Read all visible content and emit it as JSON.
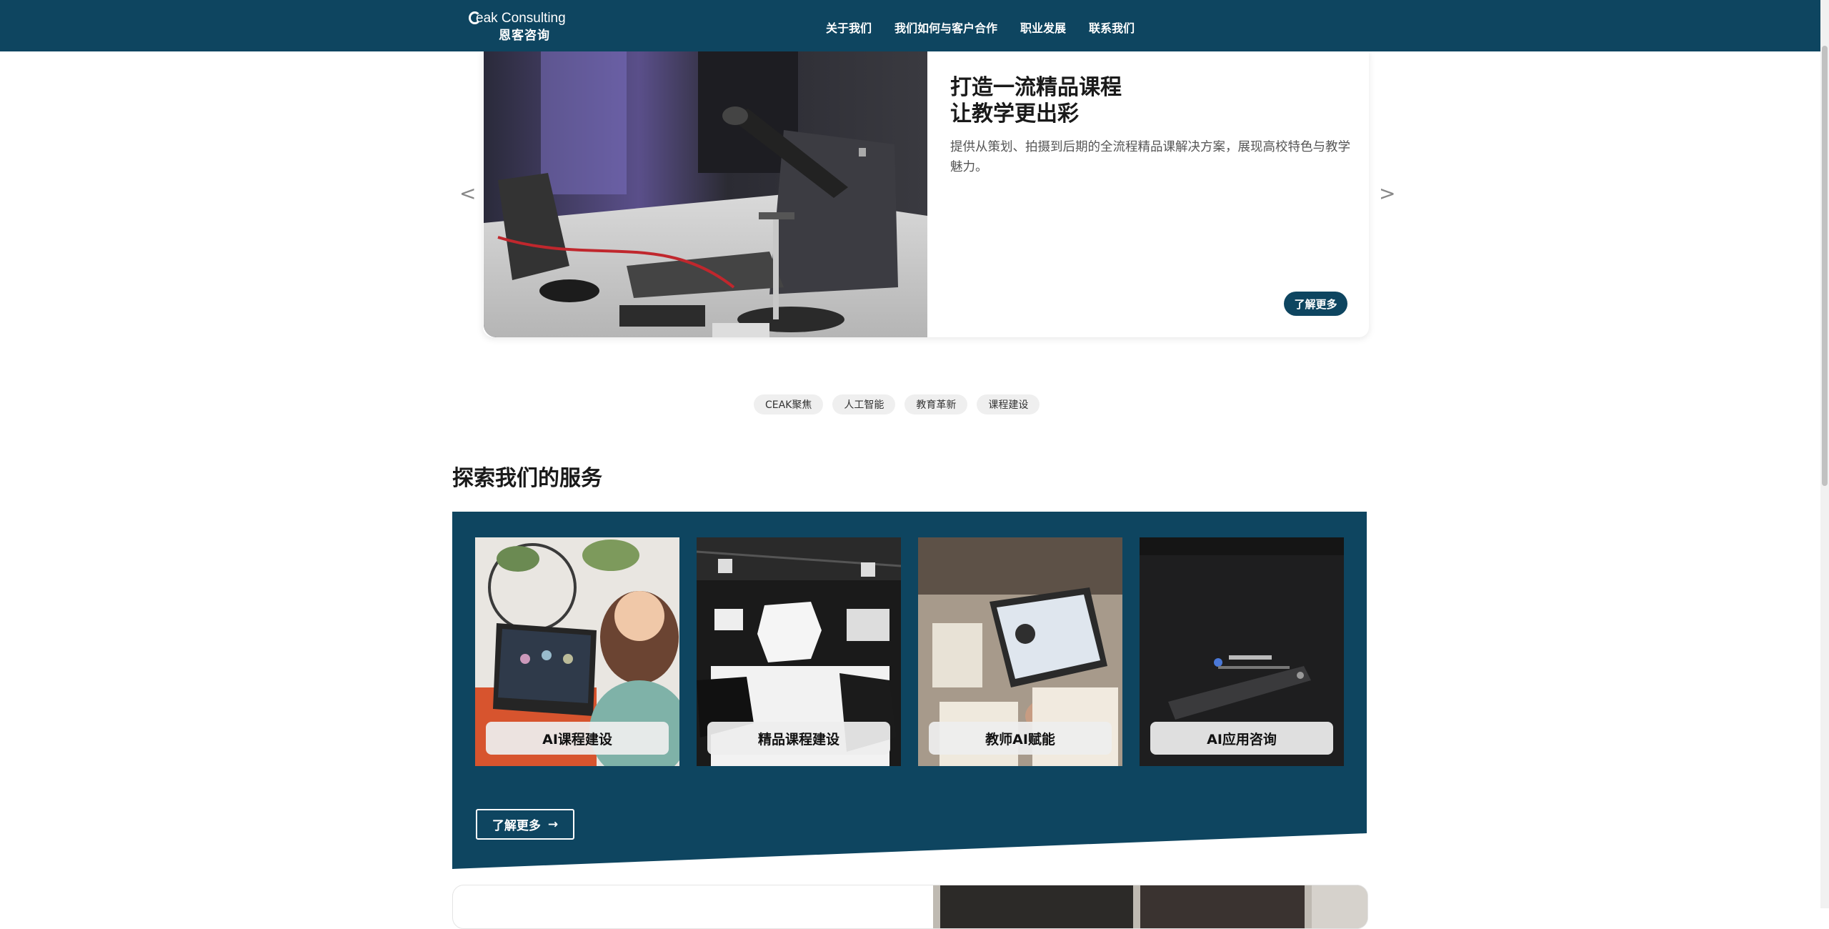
{
  "header": {
    "logo_en": "eak Consulting",
    "logo_cn": "恩客咨询",
    "nav": [
      "关于我们",
      "我们如何与客户合作",
      "职业发展",
      "联系我们"
    ]
  },
  "hero": {
    "title_line1": "打造一流精品课程",
    "title_line2": "让教学更出彩",
    "description": "提供从策划、拍摄到后期的全流程精品课解决方案，展现高校特色与教学魅力。",
    "button": "了解更多",
    "prev": "<",
    "next": ">"
  },
  "tags": [
    "CEAK聚焦",
    "人工智能",
    "教育革新",
    "课程建设"
  ],
  "services": {
    "title": "探索我们的服务",
    "cards": [
      "AI课程建设",
      "精品课程建设",
      "教师AI赋能",
      "AI应用咨询"
    ],
    "more_button": "了解更多",
    "more_arrow": "→"
  },
  "colors": {
    "brand": "#0e4560",
    "tag_bg": "#efefef"
  }
}
